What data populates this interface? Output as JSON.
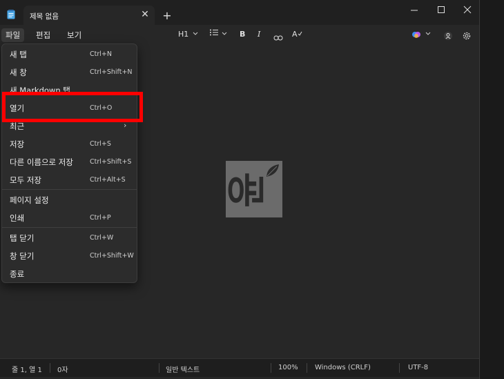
{
  "tab": {
    "title": "제목 없음",
    "close_glyph": "✕",
    "new_tab_glyph": "+"
  },
  "menubar": {
    "file": "파일",
    "edit": "편집",
    "view": "보기"
  },
  "toolbar": {
    "heading": "H1",
    "bold": "B",
    "italic": "I",
    "spellcheck": "A"
  },
  "file_menu": {
    "items": [
      {
        "label": "새 탭",
        "shortcut": "Ctrl+N"
      },
      {
        "label": "새 창",
        "shortcut": "Ctrl+Shift+N"
      },
      {
        "label": "새 Markdown 탭",
        "shortcut": ""
      },
      {
        "label": "열기",
        "shortcut": "Ctrl+O"
      },
      {
        "label": "최근",
        "shortcut": ""
      },
      {
        "label": "저장",
        "shortcut": "Ctrl+S"
      },
      {
        "label": "다른 이름으로 저장",
        "shortcut": "Ctrl+Shift+S"
      },
      {
        "label": "모두 저장",
        "shortcut": "Ctrl+Alt+S"
      },
      {
        "label": "페이지 설정",
        "shortcut": ""
      },
      {
        "label": "인쇄",
        "shortcut": "Ctrl+P"
      },
      {
        "label": "탭 닫기",
        "shortcut": "Ctrl+W"
      },
      {
        "label": "창 닫기",
        "shortcut": "Ctrl+Shift+W"
      },
      {
        "label": "종료",
        "shortcut": ""
      }
    ]
  },
  "status": {
    "position": "줄 1, 열 1",
    "chars": "0자",
    "format": "일반 텍스트",
    "zoom": "100%",
    "line_ending": "Windows (CRLF)",
    "encoding": "UTF-8"
  },
  "watermark": {
    "glyph": "윤"
  },
  "colors": {
    "highlight": "#ff0000",
    "copilot": "#c45cff"
  }
}
